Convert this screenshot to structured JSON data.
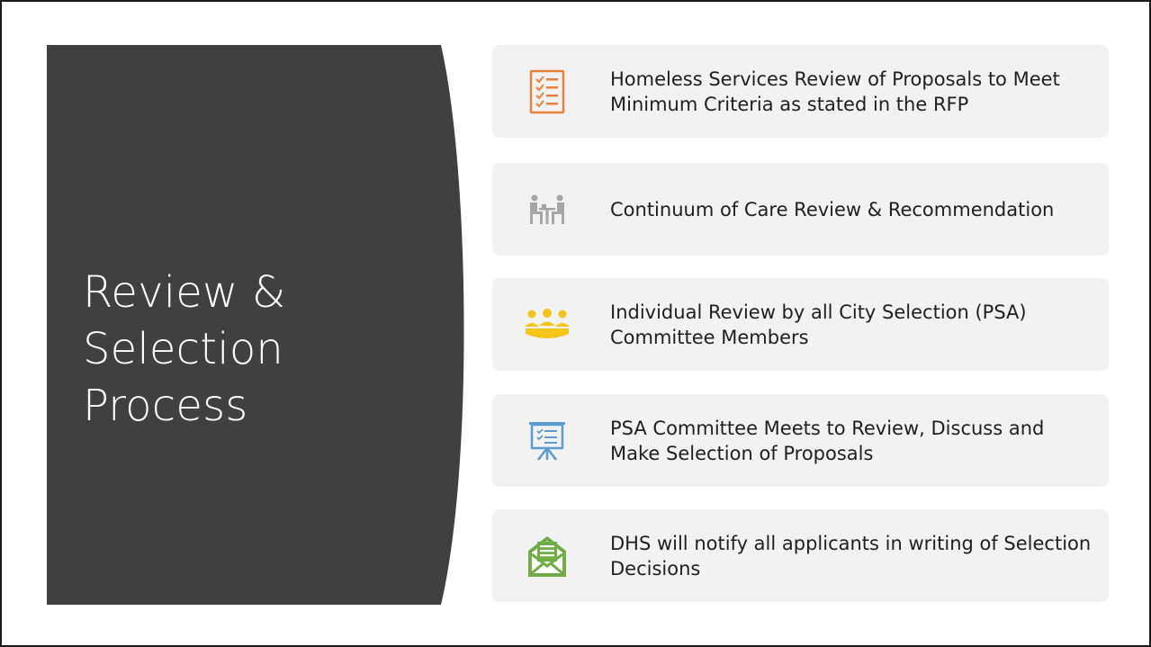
{
  "slide": {
    "title_lines": [
      "Review &",
      "Selection",
      "Process"
    ],
    "panel_color": "#404040",
    "card_color": "#f2f2f2"
  },
  "steps": [
    {
      "icon": "checklist-icon",
      "icon_color": "#e9813b",
      "text": "Homeless Services Review of Proposals to Meet Minimum Criteria as stated in the RFP"
    },
    {
      "icon": "meeting-table-icon",
      "icon_color": "#a5a5a5",
      "text": "Continuum of Care Review & Recommendation"
    },
    {
      "icon": "group-people-icon",
      "icon_color": "#f5c51a",
      "text": "Individual Review by all City Selection (PSA) Committee Members"
    },
    {
      "icon": "presentation-board-icon",
      "icon_color": "#5a9bd5",
      "text": "PSA Committee Meets to Review, Discuss and Make Selection of Proposals"
    },
    {
      "icon": "envelope-letter-icon",
      "icon_color": "#70ad47",
      "text": "DHS will notify all applicants in writing of Selection Decisions"
    }
  ]
}
